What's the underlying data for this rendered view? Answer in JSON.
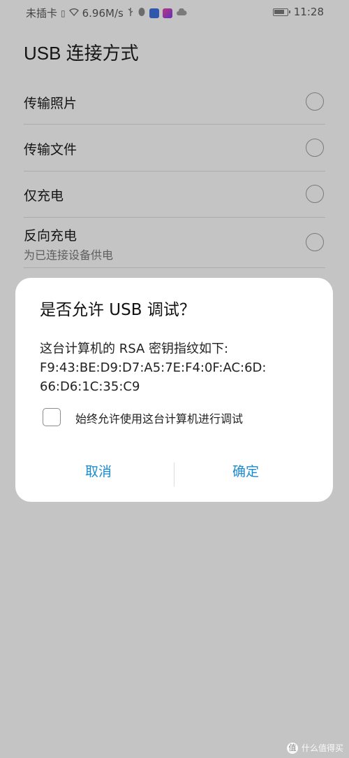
{
  "status_bar": {
    "carrier": "未插卡",
    "net_speed": "6.96M/s",
    "time": "11:28",
    "battery_level": 0.8,
    "icons": [
      "sim-icon",
      "wifi-icon",
      "usb-icon",
      "qq-icon",
      "music-app-icon",
      "pink-app-icon",
      "cloud-icon",
      "battery-icon"
    ]
  },
  "page": {
    "title": "USB 连接方式",
    "options": [
      {
        "label": "传输照片",
        "selected": false
      },
      {
        "label": "传输文件",
        "selected": false
      },
      {
        "label": "仅充电",
        "selected": false
      },
      {
        "label": "反向充电",
        "sublabel": "为已连接设备供电",
        "selected": false
      }
    ]
  },
  "dialog": {
    "title": "是否允许 USB 调试？",
    "message_line1": "这台计算机的 RSA 密钥指纹如下:",
    "message_line2": "F9:43:BE:D9:D7:A5:7E:F4:0F:AC:6D:",
    "message_line3": "66:D6:1C:35:C9",
    "checkbox_label": "始终允许使用这台计算机进行调试",
    "checkbox_checked": false,
    "cancel_label": "取消",
    "confirm_label": "确定",
    "accent_color": "#1a8bd0"
  },
  "watermark": {
    "text": "什么值得买",
    "badge": "值"
  }
}
